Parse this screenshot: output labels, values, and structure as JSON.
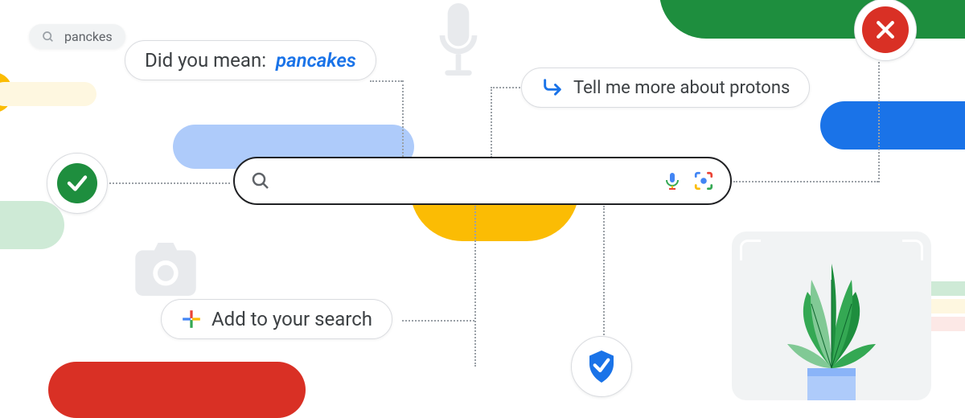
{
  "colors": {
    "blue": "#1a73e8",
    "red": "#d93025",
    "green": "#1e8e3e",
    "yellow": "#fbbc04",
    "grey": "#5f6368"
  },
  "chips": {
    "typo": {
      "query": "panckes"
    },
    "correction": {
      "prefix": "Did you mean: ",
      "suggestion": "pancakes"
    },
    "followup": {
      "text": "Tell me more about protons"
    },
    "multisearch": {
      "text": "Add to your search"
    }
  },
  "searchbar": {
    "placeholder": ""
  },
  "badges": {
    "check": "checkmark",
    "error": "close-x",
    "shield": "verified-shield"
  },
  "decor": {
    "mic": "microphone-icon",
    "camera": "camera-icon",
    "plant": "plant-illustration"
  }
}
